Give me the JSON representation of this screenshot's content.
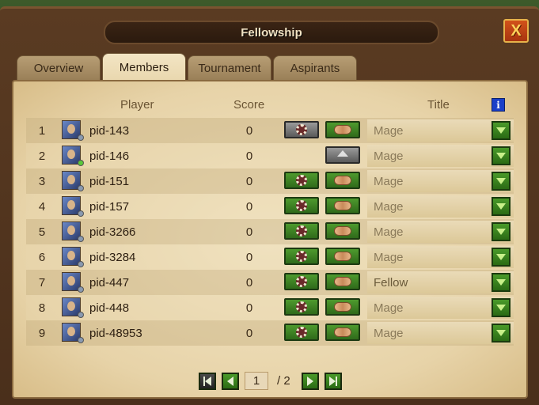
{
  "window": {
    "title": "Fellowship",
    "close_label": "X"
  },
  "tabs": [
    {
      "label": "Overview"
    },
    {
      "label": "Members"
    },
    {
      "label": "Tournament"
    },
    {
      "label": "Aspirants"
    }
  ],
  "active_tab": "Members",
  "table": {
    "headers": {
      "player": "Player",
      "score": "Score",
      "title": "Title"
    },
    "rows": [
      {
        "rank": "1",
        "name": "pid-143",
        "score": "0",
        "title": "Mage",
        "status": "offline",
        "actions": [
          "gear-grey",
          "handshake"
        ]
      },
      {
        "rank": "2",
        "name": "pid-146",
        "score": "0",
        "title": "Mage",
        "status": "online",
        "actions": [
          "home-grey"
        ]
      },
      {
        "rank": "3",
        "name": "pid-151",
        "score": "0",
        "title": "Mage",
        "status": "offline",
        "actions": [
          "gear",
          "handshake"
        ]
      },
      {
        "rank": "4",
        "name": "pid-157",
        "score": "0",
        "title": "Mage",
        "status": "offline",
        "actions": [
          "gear",
          "handshake"
        ]
      },
      {
        "rank": "5",
        "name": "pid-3266",
        "score": "0",
        "title": "Mage",
        "status": "offline",
        "actions": [
          "gear",
          "handshake"
        ]
      },
      {
        "rank": "6",
        "name": "pid-3284",
        "score": "0",
        "title": "Mage",
        "status": "offline",
        "actions": [
          "gear",
          "handshake"
        ]
      },
      {
        "rank": "7",
        "name": "pid-447",
        "score": "0",
        "title": "Fellow",
        "status": "offline",
        "actions": [
          "gear",
          "handshake"
        ]
      },
      {
        "rank": "8",
        "name": "pid-448",
        "score": "0",
        "title": "Mage",
        "status": "offline",
        "actions": [
          "gear",
          "handshake"
        ]
      },
      {
        "rank": "9",
        "name": "pid-48953",
        "score": "0",
        "title": "Mage",
        "status": "offline",
        "actions": [
          "gear",
          "handshake"
        ]
      }
    ]
  },
  "pager": {
    "current": "1",
    "total": "/ 2"
  },
  "colors": {
    "online": "#5ac83a",
    "offline": "#8a9ab0",
    "accent_green": "#3a8a20"
  }
}
